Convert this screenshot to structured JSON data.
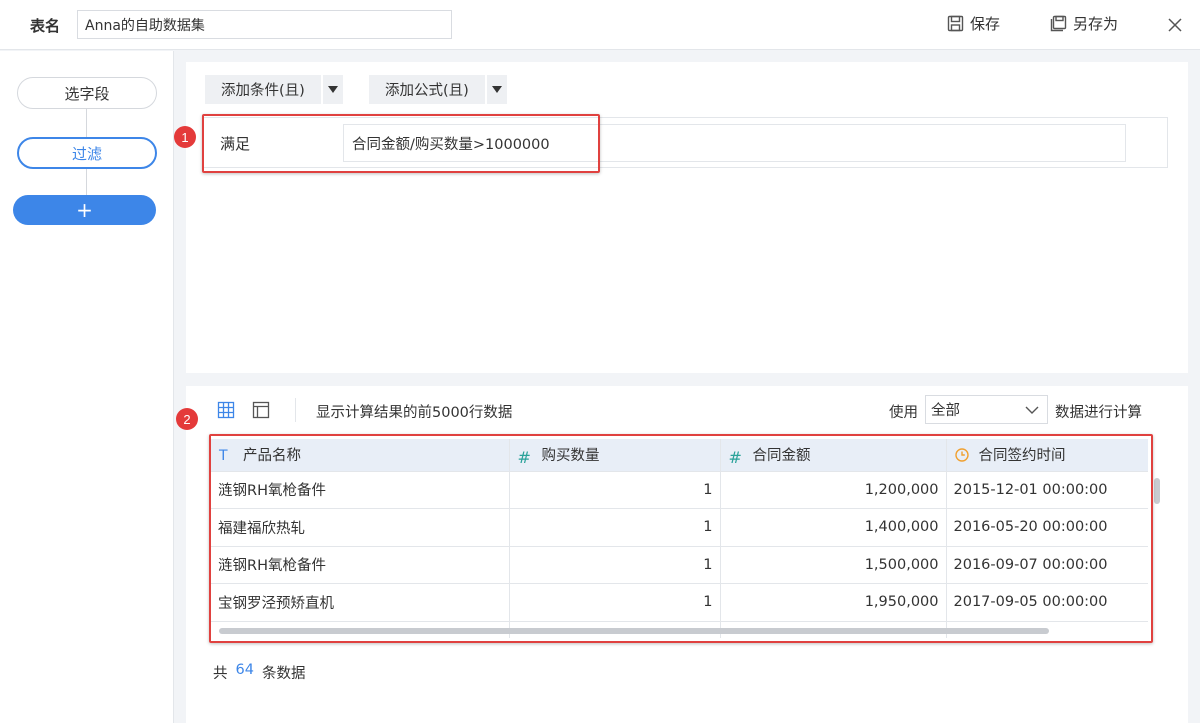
{
  "topbar": {
    "table_name_label": "表名",
    "table_name_value": "Anna的自助数据集",
    "save_label": "保存",
    "save_as_label": "另存为"
  },
  "steps": {
    "items": [
      {
        "label": "选字段"
      },
      {
        "label": "过滤"
      }
    ],
    "add_label": "+"
  },
  "filter": {
    "add_condition_label": "添加条件(且)",
    "add_formula_label": "添加公式(且)",
    "condition_label": "满足",
    "condition_value": "合同金额/购买数量>1000000"
  },
  "annotations": {
    "badge_1": "1",
    "badge_2": "2"
  },
  "preview": {
    "description": "显示计算结果的前5000行数据",
    "use_label": "使用",
    "scope_value": "全部",
    "calc_label": "数据进行计算",
    "columns": [
      {
        "name": "产品名称",
        "type_icon": "text-icon"
      },
      {
        "name": "购买数量",
        "type_icon": "number-icon"
      },
      {
        "name": "合同金额",
        "type_icon": "number-icon"
      },
      {
        "name": "合同签约时间",
        "type_icon": "clock-icon"
      }
    ],
    "rows": [
      [
        "涟钢RH氧枪备件",
        "1",
        "1,200,000",
        "2015-12-01 00:00:00"
      ],
      [
        "福建福欣热轧",
        "1",
        "1,400,000",
        "2016-05-20 00:00:00"
      ],
      [
        "涟钢RH氧枪备件",
        "1",
        "1,500,000",
        "2016-09-07 00:00:00"
      ],
      [
        "宝钢罗泾预矫直机",
        "1",
        "1,950,000",
        "2017-09-05 00:00:00"
      ]
    ],
    "total_prefix": "共",
    "total_count": "64",
    "total_suffix": "条数据"
  },
  "colors": {
    "accent": "#3d86e8",
    "highlight": "#e0413f",
    "number_icon": "#2aa29a",
    "clock_icon": "#f0a030"
  }
}
